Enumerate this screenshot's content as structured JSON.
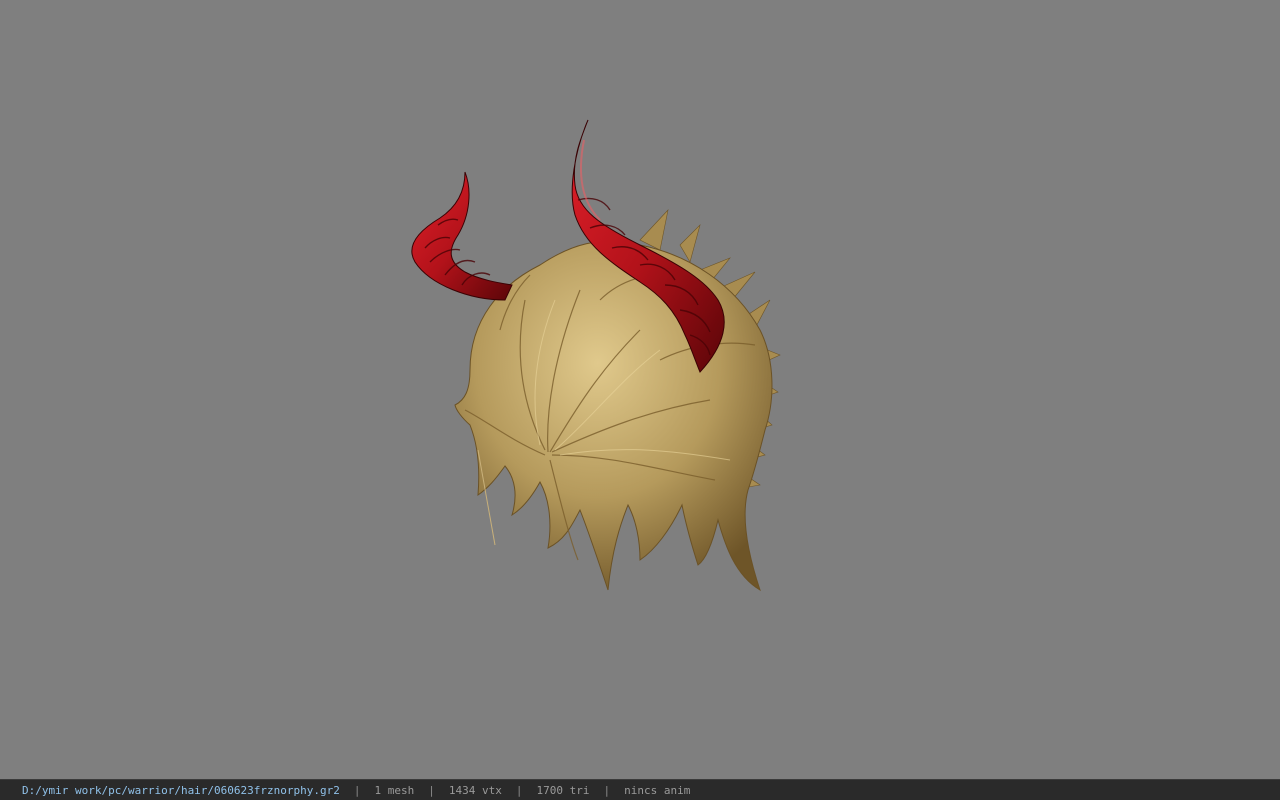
{
  "viewport": {
    "background": "#7f7f7f",
    "model": {
      "subject": "hair-with-horns",
      "hair_color": "#b59a5c",
      "horn_color": "#b3121a"
    }
  },
  "status_bar": {
    "file_path": "D:/ymir work/pc/warrior/hair/060623frznorphy.gr2",
    "separator": "|",
    "mesh_count": "1 mesh",
    "vertex_count": "1434 vtx",
    "triangle_count": "1700 tri",
    "anim_info": "nincs anim"
  }
}
